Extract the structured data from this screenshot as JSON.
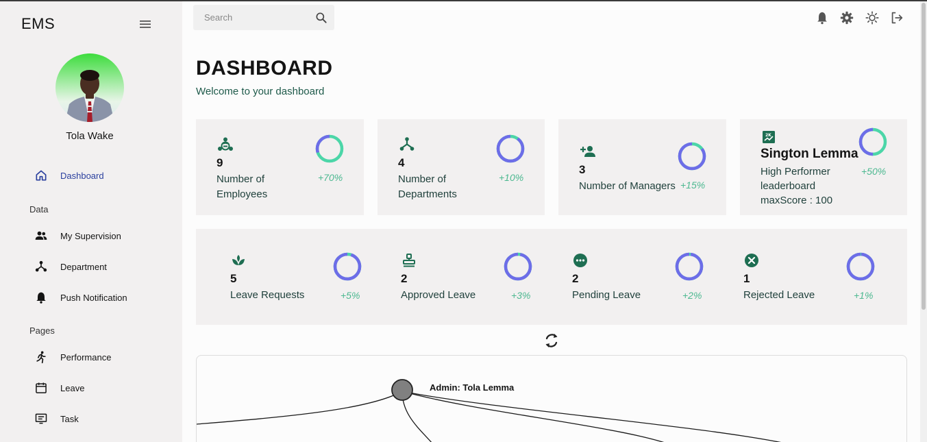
{
  "sidebar": {
    "brand": "EMS",
    "username": "Tola Wake",
    "nav_top": [
      {
        "label": "Dashboard",
        "icon": "home-icon",
        "active": true
      }
    ],
    "section_data": "Data",
    "data_items": [
      {
        "label": "My Supervision",
        "icon": "people-icon"
      },
      {
        "label": "Department",
        "icon": "hierarchy-icon"
      },
      {
        "label": "Push Notification",
        "icon": "bell-icon"
      }
    ],
    "section_pages": "Pages",
    "page_items": [
      {
        "label": "Performance",
        "icon": "running-icon"
      },
      {
        "label": "Leave",
        "icon": "calendar-icon"
      },
      {
        "label": "Task",
        "icon": "task-icon"
      }
    ]
  },
  "topbar": {
    "search_placeholder": "Search",
    "icons": [
      "bell-icon",
      "gear-icon",
      "sun-icon",
      "logout-icon"
    ]
  },
  "main": {
    "title": "DASHBOARD",
    "subtitle": "Welcome to your dashboard",
    "cards": [
      {
        "icon": "group-hub-icon",
        "value": "9",
        "label": "Number of Employees",
        "label_lines": [
          "Number of",
          "Employees"
        ],
        "percent": "+70%",
        "progress": 0.7
      },
      {
        "icon": "hierarchy-icon",
        "value": "4",
        "label": "Number of Departments",
        "label_lines": [
          "Number of",
          "Departments"
        ],
        "percent": "+10%",
        "progress": 0.1
      },
      {
        "icon": "person-add-icon",
        "value": "3",
        "label": "Number of Managers",
        "percent": "+15%",
        "progress": 0.15
      },
      {
        "icon": "leaderboard-icon",
        "name": "Sington Lemma",
        "label_lines": [
          "High Performer",
          "leaderboard",
          "maxScore : 100"
        ],
        "percent": "+50%",
        "progress": 0.5
      }
    ],
    "leave_stats": [
      {
        "icon": "spa-icon",
        "value": "5",
        "label": "Leave Requests",
        "percent": "+5%",
        "progress": 0.05
      },
      {
        "icon": "stamp-icon",
        "value": "2",
        "label": "Approved Leave",
        "percent": "+3%",
        "progress": 0.03
      },
      {
        "icon": "pending-icon",
        "value": "2",
        "label": "Pending Leave",
        "percent": "+2%",
        "progress": 0.02
      },
      {
        "icon": "cancel-icon",
        "value": "1",
        "label": "Rejected Leave",
        "percent": "+1%",
        "progress": 0.01
      }
    ],
    "refresh_icon": "refresh-icon",
    "tree": {
      "root_label": "Admin: Tola Lemma"
    }
  },
  "colors": {
    "accent_green": "#4cd6a8",
    "accent_purple": "#6d6de8",
    "icon_green": "#1e6e52",
    "nav_active": "#2a3f9e",
    "card_bg": "#f2f0f0"
  }
}
